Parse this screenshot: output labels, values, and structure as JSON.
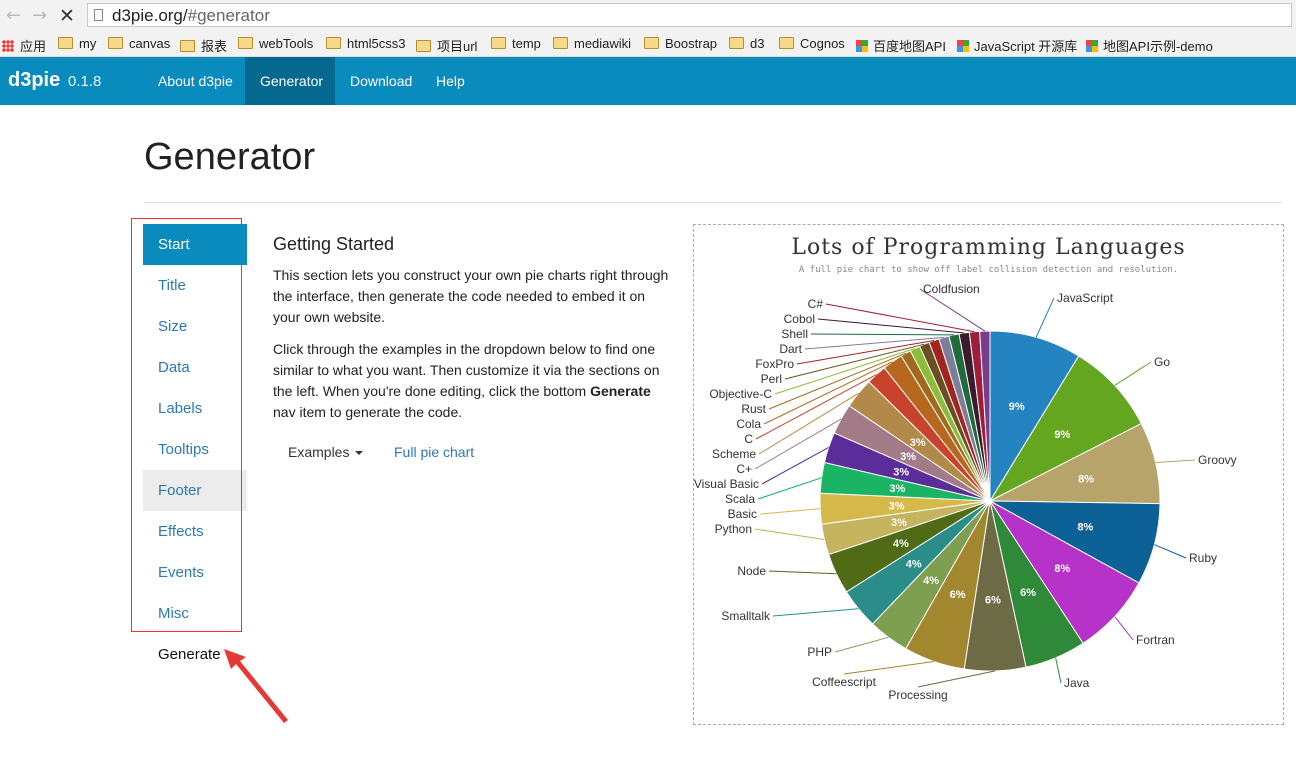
{
  "browser": {
    "url_host": "d3pie.org/",
    "url_rest": "#generator",
    "bookmarks": [
      {
        "label": "应用",
        "icon": "apps-icon"
      },
      {
        "label": "my",
        "icon": "folder-icon"
      },
      {
        "label": "canvas",
        "icon": "folder-icon"
      },
      {
        "label": "报表",
        "icon": "folder-icon"
      },
      {
        "label": "webTools",
        "icon": "folder-icon"
      },
      {
        "label": "html5css3",
        "icon": "folder-icon"
      },
      {
        "label": "项目url",
        "icon": "folder-icon"
      },
      {
        "label": "temp",
        "icon": "folder-icon"
      },
      {
        "label": "mediawiki",
        "icon": "folder-icon"
      },
      {
        "label": "Boostrap",
        "icon": "folder-icon"
      },
      {
        "label": "d3",
        "icon": "folder-icon"
      },
      {
        "label": "Cognos",
        "icon": "folder-icon"
      },
      {
        "label": "百度地图API",
        "icon": "colored-tile-icon"
      },
      {
        "label": "JavaScript 开源库",
        "icon": "colored-tile-icon"
      },
      {
        "label": "地图API示例-demo",
        "icon": "colored-tile-icon"
      }
    ]
  },
  "navbar": {
    "brand": "d3pie",
    "version": "0.1.8",
    "items": [
      "About d3pie",
      "Generator",
      "Download",
      "Help"
    ],
    "active": "Generator",
    "color": "#0a8bbd"
  },
  "page": {
    "title": "Generator",
    "sidebar": [
      "Start",
      "Title",
      "Size",
      "Data",
      "Labels",
      "Tooltips",
      "Footer",
      "Effects",
      "Events",
      "Misc",
      "Generate"
    ],
    "sidebar_active": "Start",
    "section_title": "Getting Started",
    "para1": "This section lets you construct your own pie charts right through the interface, then generate the code needed to embed it on your own website.",
    "para2_text": "Click through the examples in the dropdown below to find one similar to what you want. Then customize it via the sections on the left. When you're done editing, click the bottom ",
    "para2_bold": "Generate",
    "para2_end": " nav item to generate the code.",
    "examples_label": "Examples",
    "full_pie_label": "Full pie chart"
  },
  "chart_data": {
    "type": "pie",
    "title": "Lots of Programming Languages",
    "subtitle": "A full pie chart to show off label collision detection and resolution.",
    "slices": [
      {
        "label": "JavaScript",
        "value": 9,
        "color": "#2484c1"
      },
      {
        "label": "Go",
        "value": 9,
        "color": "#65a620"
      },
      {
        "label": "Groovy",
        "value": 8,
        "color": "#b6a46a"
      },
      {
        "label": "Ruby",
        "value": 8,
        "color": "#0c6197"
      },
      {
        "label": "Fortran",
        "value": 8,
        "color": "#b732c9"
      },
      {
        "label": "Java",
        "value": 6,
        "color": "#2e8a38"
      },
      {
        "label": "Processing",
        "value": 6,
        "color": "#6c6b46"
      },
      {
        "label": "Coffeescript",
        "value": 6,
        "color": "#a2872f"
      },
      {
        "label": "PHP",
        "value": 4,
        "color": "#7d9f4f"
      },
      {
        "label": "Smalltalk",
        "value": 4,
        "color": "#2a8d8a"
      },
      {
        "label": "Node",
        "value": 4,
        "color": "#4f6b16"
      },
      {
        "label": "Python",
        "value": 3,
        "color": "#c5b35d"
      },
      {
        "label": "Basic",
        "value": 3,
        "color": "#d5b94a"
      },
      {
        "label": "Scala",
        "value": 3,
        "color": "#1bb465"
      },
      {
        "label": "Visual Basic",
        "value": 3,
        "color": "#5b2d9b"
      },
      {
        "label": "C+",
        "value": 3,
        "color": "#a27a88"
      },
      {
        "label": "Scheme",
        "value": 3,
        "color": "#b3894a"
      },
      {
        "label": "C",
        "value": 2,
        "color": "#c9422b"
      },
      {
        "label": "Cola",
        "value": 2,
        "color": "#b8671f"
      },
      {
        "label": "Rust",
        "value": 1,
        "color": "#a06a1d"
      },
      {
        "label": "Objective-C",
        "value": 1,
        "color": "#8cbd38"
      },
      {
        "label": "Perl",
        "value": 1,
        "color": "#6b4e24"
      },
      {
        "label": "FoxPro",
        "value": 1,
        "color": "#a3241f"
      },
      {
        "label": "Dart",
        "value": 1,
        "color": "#7e7e9a"
      },
      {
        "label": "Shell",
        "value": 1,
        "color": "#1f6b3a"
      },
      {
        "label": "Cobol",
        "value": 1,
        "color": "#3b1a2c"
      },
      {
        "label": "C#",
        "value": 1,
        "color": "#9d1d3b"
      },
      {
        "label": "Coldfusion",
        "value": 1,
        "color": "#7a3d8a"
      }
    ],
    "percent_labels_on": [
      "9%",
      "9%",
      "8%",
      "8%",
      "8%",
      "6%",
      "6%",
      "6%",
      "4%",
      "4%",
      "4%",
      "3%",
      "3%",
      "3%",
      "3%",
      "3%",
      "3%"
    ]
  }
}
